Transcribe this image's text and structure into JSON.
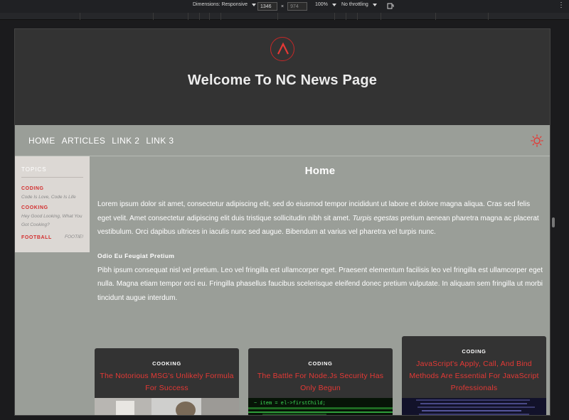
{
  "devtools": {
    "dimensions_label": "Dimensions: Responsive",
    "width_value": "1346",
    "times": "×",
    "height_value": "974",
    "zoom": "100%",
    "throttling": "No throttling"
  },
  "header": {
    "title": "Welcome To NC News Page"
  },
  "nav": {
    "links": [
      "HOME",
      "ARTICLES",
      "LINK 2",
      "LINK 3"
    ]
  },
  "sidebar": {
    "title": "TOPICS",
    "topics": [
      {
        "name": "CODING",
        "description": "Code Is Love, Code Is Life"
      },
      {
        "name": "COOKING",
        "description": "Hey Good Looking, What You Got Cooking?"
      },
      {
        "name": "FOOTBALL",
        "description": "FOOTIE!"
      }
    ]
  },
  "main": {
    "heading": "Home",
    "intro_before_em": "Lorem ipsum dolor sit amet, consectetur adipiscing elit, sed do eiusmod tempor incididunt ut labore et dolore magna aliqua. Cras sed felis eget velit. Amet consectetur adipiscing elit duis tristique sollicitudin nibh sit amet. ",
    "intro_em": "Turpis egestas",
    "intro_after_em": " pretium aenean pharetra magna ac placerat vestibulum. Orci dapibus ultrices in iaculis nunc sed augue. Bibendum at varius vel pharetra vel turpis nunc.",
    "subheading": "Odio Eu Feugiat Pretium",
    "body": "Pibh ipsum consequat nisl vel pretium. Leo vel fringilla est ullamcorper eget. Praesent elementum facilisis leo vel fringilla est ullamcorper eget nulla. Magna etiam tempor orci eu. Fringilla phasellus faucibus scelerisque eleifend donec pretium vulputate. In aliquam sem fringilla ut morbi tincidunt augue interdum."
  },
  "cards": [
    {
      "topic": "COOKING",
      "title": "The Notorious MSG's Unlikely Formula For Success"
    },
    {
      "topic": "CODING",
      "title": "The Battle For Node.Js Security Has Only Begun"
    },
    {
      "topic": "CODING",
      "title": "JavaScript's Apply, Call, And Bind Methods Are Essential For JavaScript Professionals"
    }
  ],
  "colors": {
    "accent": "#e53935",
    "hero_bg": "#333333",
    "page_bg": "#9a9e98"
  },
  "icons": {
    "logo": "brand-logo-icon",
    "theme_toggle": "sun-icon"
  }
}
